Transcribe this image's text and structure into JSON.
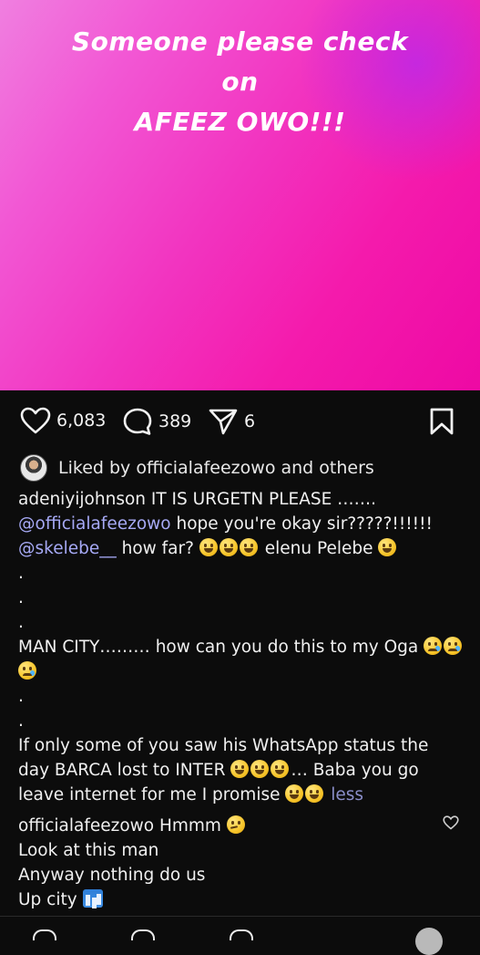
{
  "post": {
    "text_line1": "Someone please check",
    "text_line2": "on",
    "text_line3": "AFEEZ OWO!!!"
  },
  "actions": {
    "likes": "6,083",
    "comments": "389",
    "shares": "6"
  },
  "liked_by": "Liked by officialafeezowo and others",
  "caption": {
    "username": "adeniyijohnson",
    "line1_text": " IT IS URGETN PLEASE …….",
    "mention1": "@officialafeezowo",
    "line2_text": " hope you're okay sir?????!!!!!!",
    "mention2": "@skelebe__",
    "line3_text": " how far?",
    "line3_tail": " elenu Pelebe",
    "dot": ".",
    "man_city_text": "MAN CITY……… how can you do this to my Oga",
    "whatsapp_line1": "If only some of you saw his WhatsApp status the",
    "whatsapp_line2": "day BARCA lost to INTER",
    "whatsapp_line2_tail": "… Baba you go",
    "whatsapp_line3": "leave internet for me I promise",
    "less": "less"
  },
  "comment": {
    "username": "officialafeezowo",
    "line1_text": " Hmmm",
    "line2": "Look at this man",
    "line3": "Anyway nothing do us",
    "line4": "Up city"
  },
  "icons": [
    "heart-icon",
    "comment-icon",
    "share-icon",
    "bookmark-icon",
    "heart-outline-icon",
    "grinning-face-emoji",
    "crying-face-emoji",
    "thinking-face-emoji",
    "cityscape-emoji"
  ]
}
